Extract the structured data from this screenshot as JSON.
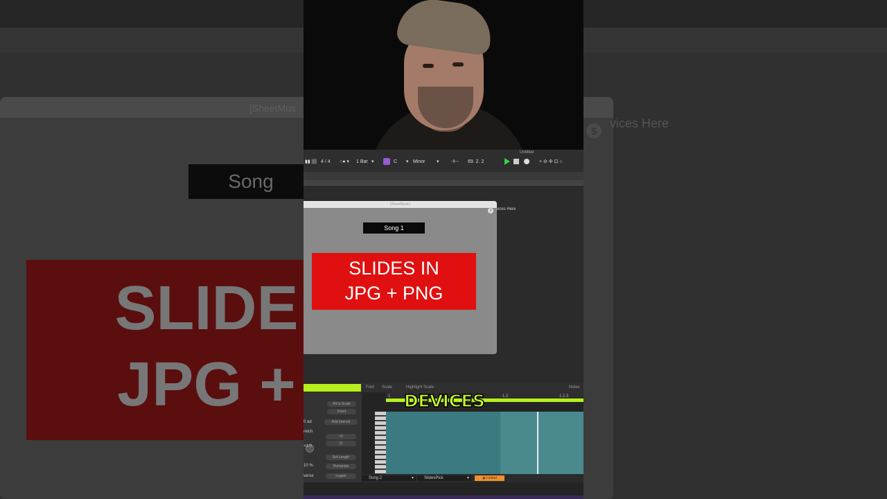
{
  "background": {
    "window_title": "[SheetMus",
    "song_label": "Song",
    "slide_line1": "SLIDE",
    "slide_line2": "JPG +",
    "devices_hint": "vices Here",
    "circle_icon": "$"
  },
  "transport": {
    "time_signature": "4 / 4",
    "quantize": "1 Bar",
    "key": "C",
    "scale": "Minor",
    "position": "69.  2.  2",
    "title": "Untitled"
  },
  "sheet_window": {
    "title": "[SheetMusic]",
    "song_label": "Song 1",
    "slide_line1": "SLIDES IN",
    "slide_line2": "JPG + PNG",
    "devices_hint": "vices Here"
  },
  "clip": {
    "tabs": {
      "fold": "Fold",
      "scale": "Scale",
      "highlight": "Highlight Scale",
      "notes": "Notes"
    },
    "left_panel": {
      "fit_to_scale": "Fit to Scale",
      "invert": "Invert",
      "add_value": "0 ad",
      "add_interval": "Add Interval",
      "stretch": "retch",
      "x2": "×2",
      "div2": "/2",
      "x1": "×1.0",
      "set_length": "Set Length",
      "percent": "10 %",
      "humanize": "Humanize",
      "reverse": "verse",
      "legato": "Legato"
    },
    "ruler": {
      "m1": "1",
      "m2": "1.2",
      "m3": "1.2.3"
    },
    "caption": "DEVICES",
    "bottom": {
      "song": "Song 2",
      "slides_pick": "SlidesPick",
      "linked": "Linked"
    }
  }
}
